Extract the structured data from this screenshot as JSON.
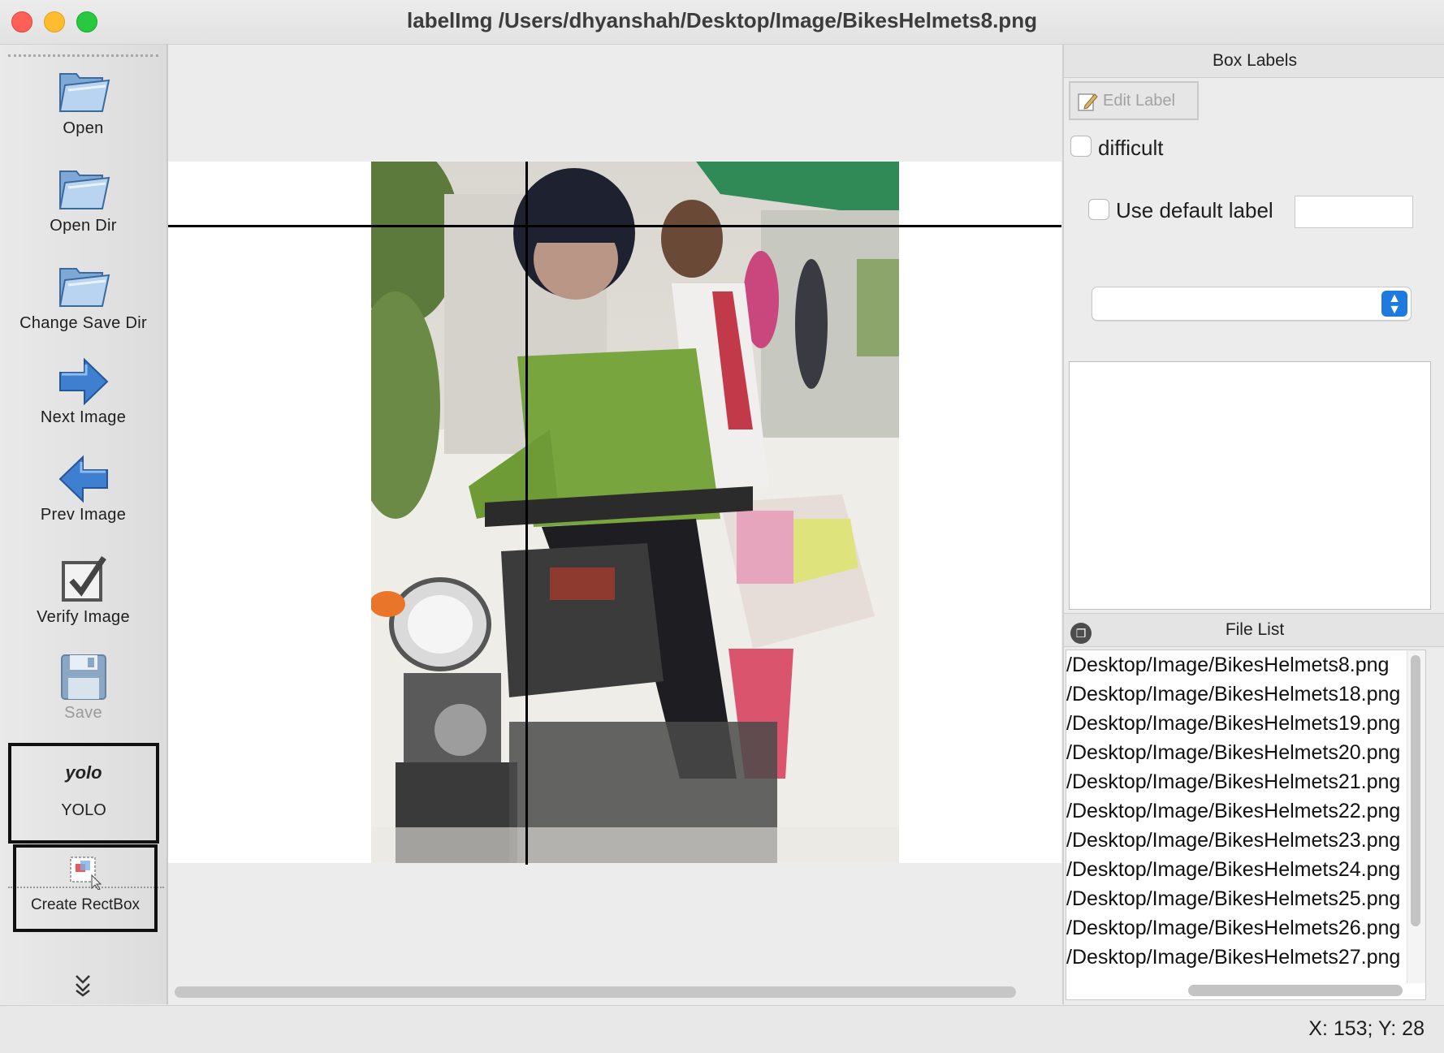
{
  "window": {
    "title": "labelImg /Users/dhyanshah/Desktop/Image/BikesHelmets8.png"
  },
  "toolbar": {
    "open": "Open",
    "open_dir": "Open Dir",
    "change_save_dir": "Change Save Dir",
    "next_image": "Next Image",
    "prev_image": "Prev Image",
    "verify_image": "Verify Image",
    "save": "Save",
    "format_badge": "yolo",
    "format_label": "YOLO",
    "create_rectbox": "Create RectBox",
    "more": "»"
  },
  "icons": {
    "open": "folder-icon",
    "open_dir": "folder-icon",
    "change_save_dir": "folder-icon",
    "next": "arrow-right-icon",
    "prev": "arrow-left-icon",
    "verify": "checkbox-icon",
    "save": "floppy-icon",
    "rectbox": "rectbox-icon",
    "edit": "pencil-icon"
  },
  "box_labels": {
    "title": "Box Labels",
    "edit_label": "Edit Label",
    "difficult": "difficult",
    "use_default_label": "Use default label",
    "default_label_value": "",
    "selected_label": ""
  },
  "file_list": {
    "title": "File List",
    "items": [
      "/Desktop/Image/BikesHelmets8.png",
      "/Desktop/Image/BikesHelmets18.png",
      "/Desktop/Image/BikesHelmets19.png",
      "/Desktop/Image/BikesHelmets20.png",
      "/Desktop/Image/BikesHelmets21.png",
      "/Desktop/Image/BikesHelmets22.png",
      "/Desktop/Image/BikesHelmets23.png",
      "/Desktop/Image/BikesHelmets24.png",
      "/Desktop/Image/BikesHelmets25.png",
      "/Desktop/Image/BikesHelmets26.png",
      "/Desktop/Image/BikesHelmets27.png"
    ]
  },
  "status": {
    "coords": "X: 153; Y: 28"
  },
  "colors": {
    "accent": "#1f7ae0",
    "close": "#fe5f57",
    "minimize": "#febc2e",
    "maximize": "#28c840"
  }
}
